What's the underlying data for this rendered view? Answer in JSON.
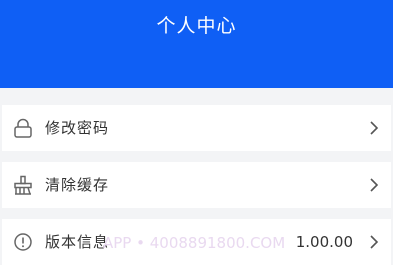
{
  "header": {
    "title": "个人中心",
    "background": "#0f5ff5"
  },
  "menu": [
    {
      "label": "修改密码",
      "icon": "lock-icon",
      "chevron": "chevron-right-icon"
    },
    {
      "label": "清除缓存",
      "icon": "broom-icon",
      "chevron": "chevron-right-icon"
    },
    {
      "label": "版本信息",
      "icon": "info-icon",
      "value": "1.00.00",
      "chevron": "chevron-right-icon"
    }
  ],
  "watermark": "APP • 4008891800.COM"
}
